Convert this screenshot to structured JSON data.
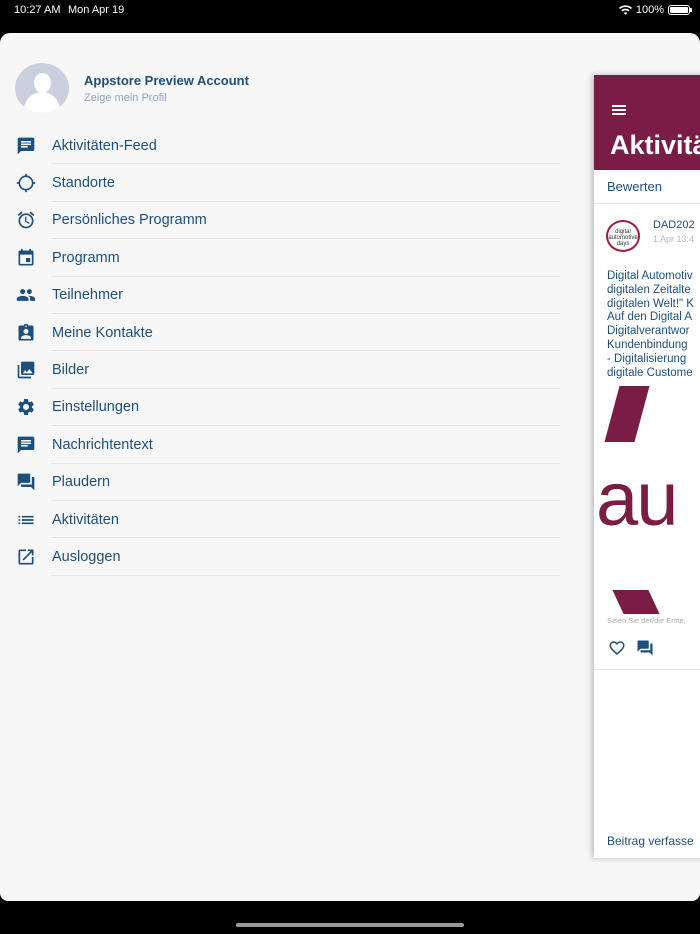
{
  "status_bar": {
    "time": "10:27 AM",
    "date": "Mon Apr 19",
    "battery": "100%",
    "battery_level": 1.0
  },
  "profile": {
    "name": "Appstore Preview Account",
    "subtitle": "Zeige mein Profil"
  },
  "menu": {
    "items": [
      {
        "label": "Aktivitäten-Feed",
        "icon": "chat-bubble-icon"
      },
      {
        "label": "Standorte",
        "icon": "crosshair-icon"
      },
      {
        "label": "Persönliches Programm",
        "icon": "alarm-icon"
      },
      {
        "label": "Programm",
        "icon": "calendar-icon"
      },
      {
        "label": "Teilnehmer",
        "icon": "people-icon"
      },
      {
        "label": "Meine Kontakte",
        "icon": "contact-card-icon"
      },
      {
        "label": "Bilder",
        "icon": "photo-library-icon"
      },
      {
        "label": "Einstellungen",
        "icon": "gear-icon"
      },
      {
        "label": "Nachrichtentext",
        "icon": "message-text-icon"
      },
      {
        "label": "Plaudern",
        "icon": "forum-icon"
      },
      {
        "label": "Aktivitäten",
        "icon": "list-icon"
      },
      {
        "label": "Ausloggen",
        "icon": "open-external-icon"
      }
    ]
  },
  "feed_panel": {
    "title": "Aktivitä",
    "rate_label": "Bewerten",
    "post": {
      "author": "DAD202",
      "time": "1 Apr 13:4",
      "logo_lines": [
        "digital",
        "automotive",
        "days"
      ],
      "text_lines": [
        "Digital Automotiv",
        "digitalen Zeitalte",
        "digitalen Welt!\" K",
        "Auf den Digital A",
        "Digitalverantwor",
        "Kundenbindung",
        "- Digitalisierung",
        "digitale Custome"
      ],
      "image_wordmark": "au",
      "first_hint": "Seien Sie der/die Erste,"
    },
    "compose_label": "Beitrag verfasse"
  },
  "colors": {
    "accent": "#1d4f7c",
    "brand": "#7b1c45",
    "background": "#f7f7f7"
  }
}
